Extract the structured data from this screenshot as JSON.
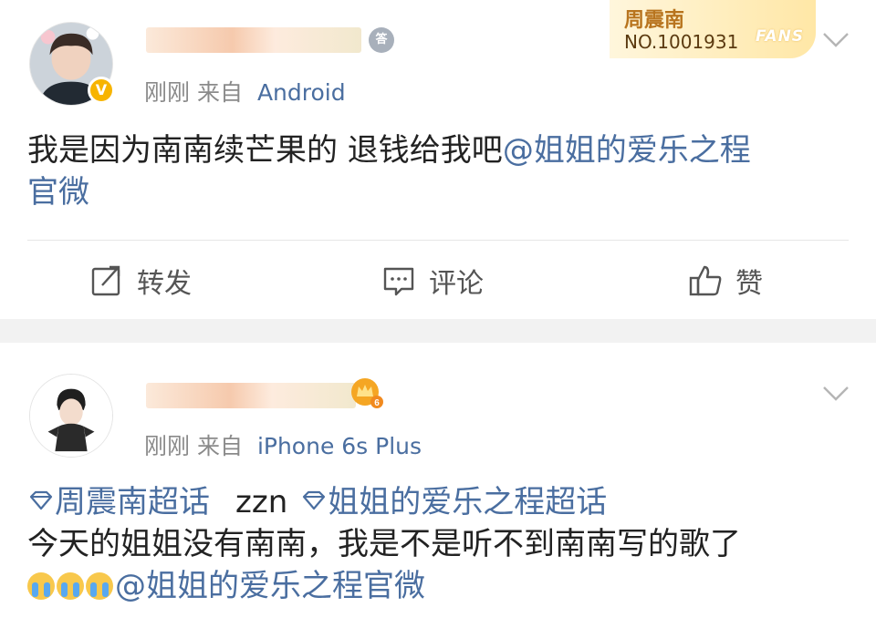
{
  "post1": {
    "level_badge": "答",
    "verified_badge": "V",
    "time": "刚刚",
    "source_prefix": "来自",
    "source": "Android",
    "fans_card": {
      "name": "周震南",
      "number": "NO.1001931",
      "mark": "FANS"
    },
    "content": {
      "text": "我是因为南南续芒果的 退钱给我吧",
      "mention_line1": "@姐姐的爱乐之程",
      "mention_line2": "官微"
    },
    "actions": {
      "repost": "转发",
      "comment": "评论",
      "like": "赞"
    }
  },
  "post2": {
    "time": "刚刚",
    "source_prefix": "来自",
    "source": "iPhone 6s Plus",
    "crown_level": "6",
    "content": {
      "topic1": "周震南超话",
      "plain": "zzn",
      "topic2": "姐姐的爱乐之程超话",
      "line2": "今天的姐姐没有南南，我是不是听不到南南写的歌了",
      "mention": "@姐姐的爱乐之程官微"
    }
  },
  "colors": {
    "link": "#4a6ea0",
    "meta": "#8a8a8a",
    "verified": "#f7b400",
    "fans": "#ffe7a6"
  }
}
